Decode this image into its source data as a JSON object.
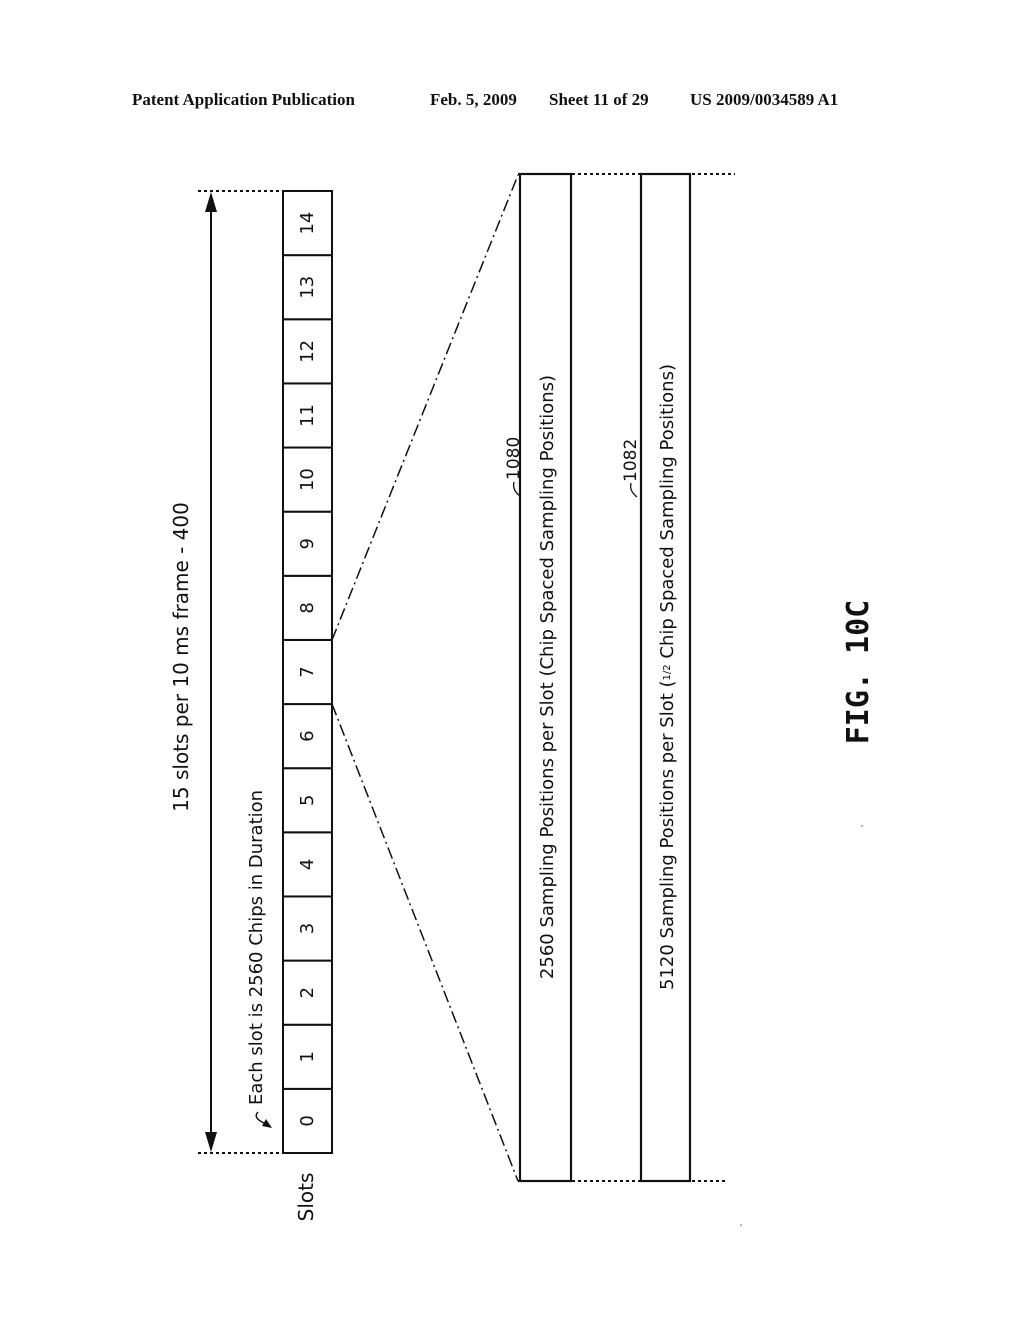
{
  "header": {
    "left": "Patent Application Publication",
    "date": "Feb. 5, 2009",
    "sheet": "Sheet 11 of 29",
    "number": "US 2009/0034589 A1"
  },
  "figure": {
    "title": "FIG. 10C",
    "frame_label": "15 slots per 10 ms frame - 400",
    "slot_duration_label": "Each slot is 2560 Chips in Duration",
    "slots_axis_label": "Slots",
    "slots": [
      "0",
      "1",
      "2",
      "3",
      "4",
      "5",
      "6",
      "7",
      "8",
      "9",
      "10",
      "11",
      "12",
      "13",
      "14"
    ],
    "expanded_slot": "7",
    "bars": [
      {
        "ref": "1080",
        "label": "2560 Sampling Positions per Slot (Chip Spaced Sampling Positions)"
      },
      {
        "ref": "1082",
        "label_pre": "5120 Sampling Positions per Slot (",
        "fraction_num": "1",
        "fraction_den": "2",
        "label_post": " Chip Spaced Sampling Positions)"
      }
    ]
  }
}
